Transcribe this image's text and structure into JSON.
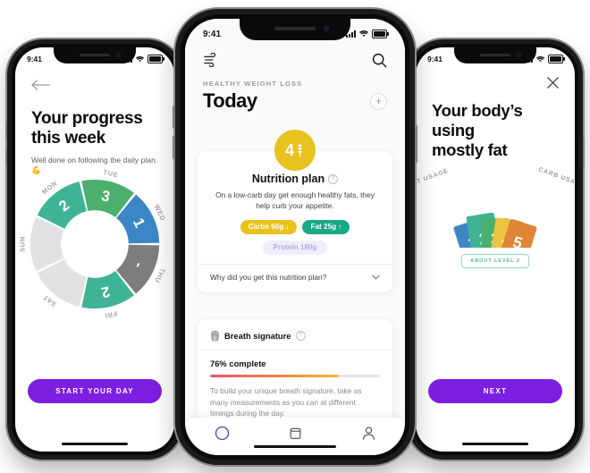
{
  "meta": {
    "status_time": "9:41",
    "accent_purple": "#7d1fe0",
    "accent_yellow": "#e8c21f",
    "accent_teal": "#17a884"
  },
  "left_phone": {
    "back_icon": "arrow-left-icon",
    "title": "Your progress\nthis week",
    "title_line1": "Your progress",
    "title_line2": "this week",
    "subtitle": "Well done on following the daily plan. 💪",
    "cta_label": "START YOUR DAY",
    "chart_data": {
      "type": "pie",
      "title": "Your progress this week",
      "subtype": "donut",
      "categories": [
        "SUN",
        "MON",
        "TUE",
        "WED",
        "THU",
        "FRI",
        "SAT"
      ],
      "values": [
        null,
        2,
        3,
        1,
        null,
        2,
        null
      ],
      "labels": [
        "",
        "2",
        "3",
        "1",
        "-",
        "2",
        ""
      ],
      "colors": [
        "#e2e2e4",
        "#3fb494",
        "#4caf6d",
        "#3d86c6",
        "#7d7d80",
        "#3fb494",
        "#e2e2e4"
      ],
      "legend": "none",
      "grid": false
    }
  },
  "center_phone": {
    "wind_icon": "wind-icon",
    "search_icon": "search-icon",
    "eyebrow": "HEALTHY WEIGHT LOSS",
    "title": "Today",
    "add_label": "+",
    "badge": {
      "value": "4",
      "icon": "wheat-icon"
    },
    "nutrition": {
      "heading": "Nutrition plan",
      "help_label": "?",
      "description": "On a low-carb day get enough healthy fats, they help curb your appetite.",
      "pills": [
        {
          "label": "Carbs 60g",
          "arrow": "↓",
          "color": "#e8c21f"
        },
        {
          "label": "Fat 25g",
          "arrow": "↑",
          "color": "#17a884"
        }
      ],
      "protein": "Protein 180g",
      "why_label": "Why did you get this nutrition plan?",
      "chevron_icon": "chevron-down-icon"
    },
    "breath": {
      "icon": "fingerprint-icon",
      "heading": "Breath signature",
      "help_label": "?",
      "percent_label": "76% complete",
      "percent_value": 76,
      "note": "To build your unique breath signature, take as many measurements as you can at different timings during the day."
    },
    "tabbar": [
      {
        "name": "home",
        "icon": "circle-icon",
        "active": true
      },
      {
        "name": "library",
        "icon": "card-icon",
        "active": false
      },
      {
        "name": "profile",
        "icon": "person-icon",
        "active": false
      }
    ]
  },
  "right_phone": {
    "close_icon": "close-icon",
    "title_line1": "Your body’s using",
    "title_line2": "mostly fat",
    "left_axis_label": "FAT USAGE",
    "right_axis_label": "CARB USAGE",
    "about_label": "ABOUT LEVEL 2",
    "cta_label": "NEXT",
    "chart_data": {
      "type": "bar",
      "subtype": "level-gauge",
      "title": "Your body’s using mostly fat",
      "categories": [
        "1",
        "2",
        "3",
        "4",
        "5"
      ],
      "values": [
        1,
        2,
        3,
        4,
        5
      ],
      "active_index": 1,
      "colors": [
        "#3d86c6",
        "#3fb494",
        "#4caf6d",
        "#ecc43f",
        "#e08435"
      ],
      "xlabel": "FAT USAGE → CARB USAGE",
      "ylabel": "",
      "grid": false,
      "legend": "none"
    }
  }
}
